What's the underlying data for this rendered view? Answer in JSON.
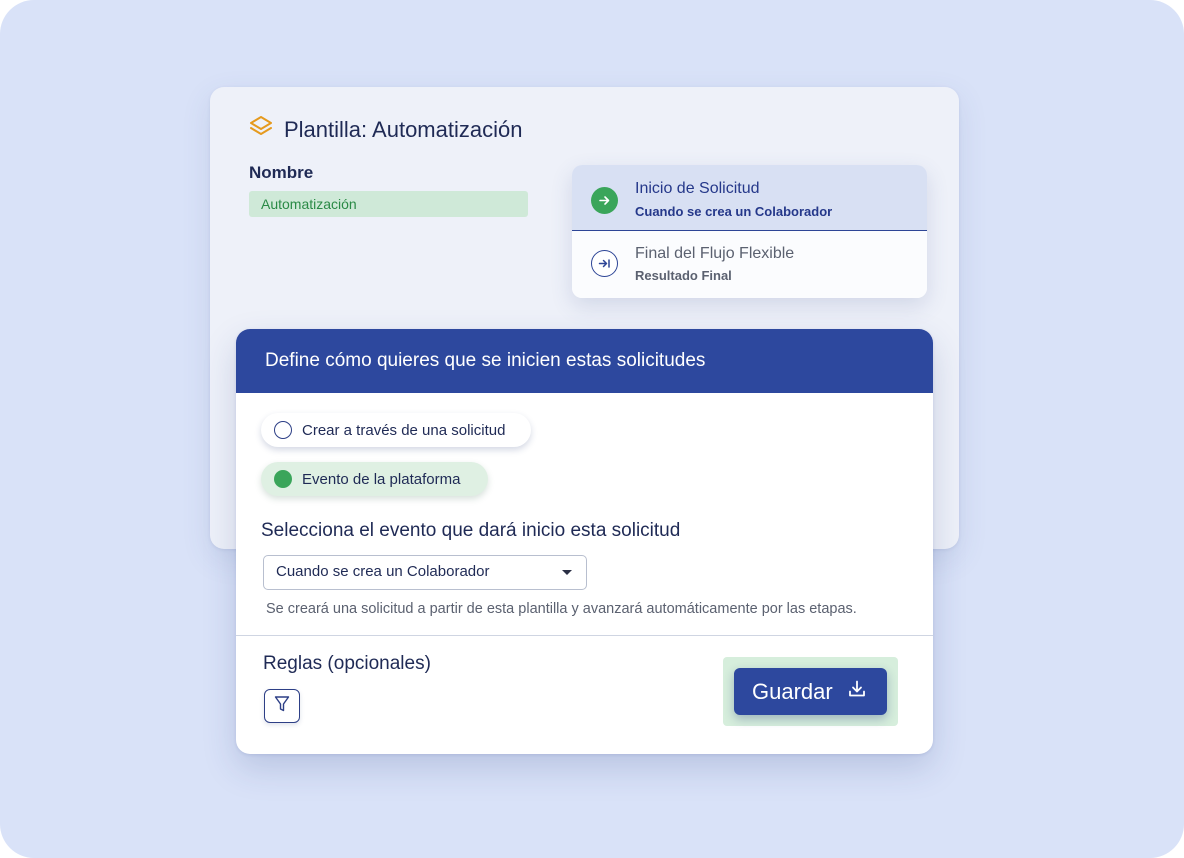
{
  "template": {
    "title": "Plantilla: Automatización",
    "icon": "layers-icon",
    "name_label": "Nombre",
    "name_value": "Automatización"
  },
  "flow": {
    "items": [
      {
        "title": "Inicio de Solicitud",
        "subtitle": "Cuando se crea un Colaborador",
        "icon": "arrow-right-circle-icon",
        "active": true
      },
      {
        "title": "Final del Flujo Flexible",
        "subtitle": "Resultado Final",
        "icon": "arrow-to-end-icon",
        "active": false
      }
    ]
  },
  "start": {
    "header": "Define cómo quieres que se inicien estas solicitudes",
    "options": [
      {
        "label": "Crear a través de una solicitud",
        "selected": false
      },
      {
        "label": "Evento de la plataforma",
        "selected": true
      }
    ],
    "event_label": "Selecciona el evento que dará inicio esta solicitud",
    "event_selected": "Cuando se crea un Colaborador",
    "helper": "Se creará una solicitud a partir de esta plantilla y avanzará automáticamente por las etapas.",
    "rules_label": "Reglas (opcionales)",
    "filter_icon": "filter-icon",
    "save_label": "Guardar",
    "save_icon": "download-icon"
  },
  "colors": {
    "background": "#d9e2f8",
    "primary": "#2d489e",
    "success": "#3aa55a",
    "success_light": "#dff0e3",
    "accent_orange": "#e59a1e"
  }
}
